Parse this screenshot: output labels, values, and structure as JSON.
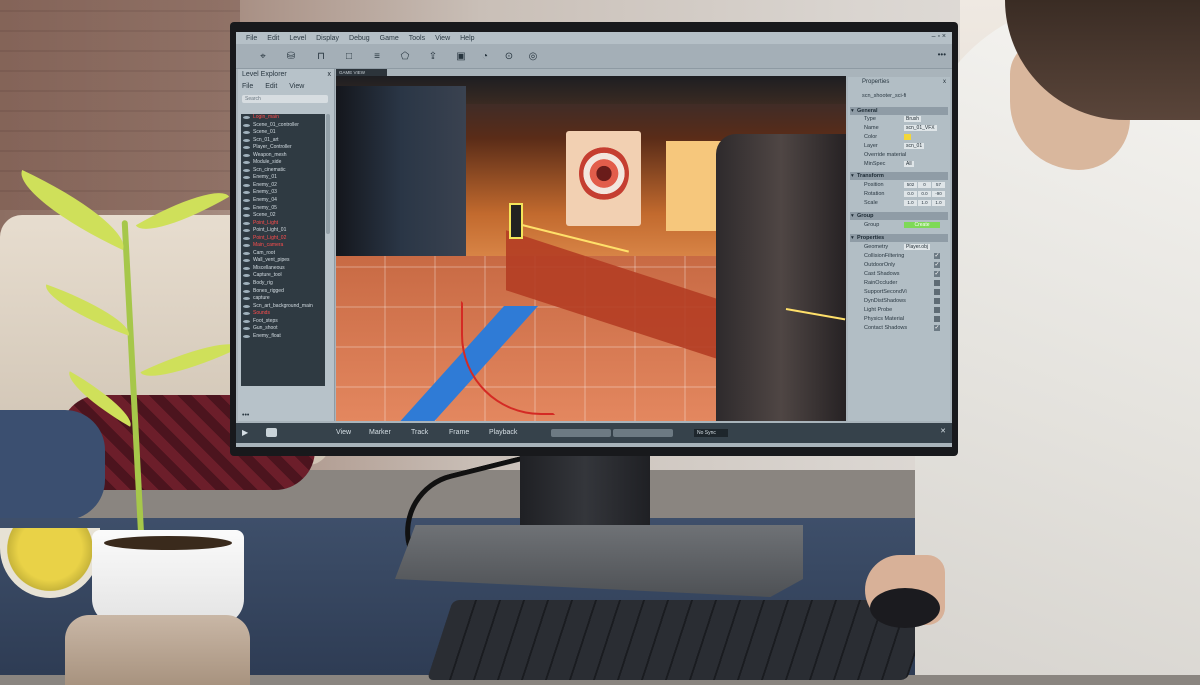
{
  "menu": [
    "File",
    "Edit",
    "Level",
    "Display",
    "Debug",
    "Game",
    "Tools",
    "View",
    "Help"
  ],
  "window_buttons": "– ▫ ×",
  "toolbar": {
    "icons": [
      "select-icon",
      "cylinder-icon",
      "brush-icon",
      "square-icon",
      "list-icon",
      "pentagon-icon",
      "export-icon",
      "save-icon",
      "user-icon",
      "settings-icon",
      "target-icon"
    ],
    "more": "•••"
  },
  "explorer": {
    "title": "Level Explorer",
    "close": "x",
    "menu": [
      "File",
      "Edit",
      "View"
    ],
    "search_placeholder": "Search",
    "items": [
      {
        "label": "Login_main",
        "highlight": true
      },
      {
        "label": "Scene_01_controller",
        "highlight": false
      },
      {
        "label": "Scene_01",
        "highlight": false
      },
      {
        "label": "Scn_01_art",
        "highlight": false
      },
      {
        "label": "Player_Controller",
        "highlight": false
      },
      {
        "label": "Weapon_mesh",
        "highlight": false
      },
      {
        "label": "Module_side",
        "highlight": false
      },
      {
        "label": "Scn_cinematic",
        "highlight": false
      },
      {
        "label": "Enemy_01",
        "highlight": false
      },
      {
        "label": "Enemy_02",
        "highlight": false
      },
      {
        "label": "Enemy_03",
        "highlight": false
      },
      {
        "label": "Enemy_04",
        "highlight": false
      },
      {
        "label": "Enemy_05",
        "highlight": false
      },
      {
        "label": "Scene_02",
        "highlight": false
      },
      {
        "label": "Point_Light",
        "highlight": true
      },
      {
        "label": "Point_Light_01",
        "highlight": false
      },
      {
        "label": "Point_Light_02",
        "highlight": true
      },
      {
        "label": "Main_camera",
        "highlight": true
      },
      {
        "label": "Cam_root",
        "highlight": false
      },
      {
        "label": "Wall_vent_pipes",
        "highlight": false
      },
      {
        "label": "Miscellaneous",
        "highlight": false
      },
      {
        "label": "Capture_tool",
        "highlight": false
      },
      {
        "label": "Body_rig",
        "highlight": false
      },
      {
        "label": "Bones_rigged",
        "highlight": false
      },
      {
        "label": "capture",
        "highlight": false
      },
      {
        "label": "Scn_art_background_main",
        "highlight": false
      },
      {
        "label": "Sounds",
        "highlight": true
      },
      {
        "label": "Foot_steps",
        "highlight": false
      },
      {
        "label": "Gun_shoot",
        "highlight": false
      },
      {
        "label": "Enemy_float",
        "highlight": false
      }
    ],
    "more": "•••"
  },
  "viewport": {
    "tab": "GAME VIEW"
  },
  "properties": {
    "title": "Properties",
    "close": "x",
    "object": "scn_shooter_sci-fi",
    "general": {
      "label": "General",
      "type_label": "Type",
      "type_value": "Brush",
      "name_label": "Name",
      "name_value": "scn_01_VFX",
      "color_label": "Color",
      "color_value": "#f2d63a",
      "layer_label": "Layer",
      "layer_value": "scn_01",
      "override_label": "Override material",
      "minspec_label": "MinSpec",
      "minspec_value": "All"
    },
    "transform": {
      "label": "Transform",
      "position_label": "Position",
      "position": [
        "502",
        "0",
        "57"
      ],
      "rotation_label": "Rotation",
      "rotation": [
        "0.0",
        "0.0",
        "-90"
      ],
      "scale_label": "Scale",
      "scale": [
        "1.0",
        "1.0",
        "1.0"
      ]
    },
    "group": {
      "label": "Group",
      "group_label": "Group",
      "create_label": "Create"
    },
    "props": {
      "label": "Properties",
      "geometry_label": "Geometry",
      "geometry_value": "Player.obj",
      "flags": [
        {
          "label": "CollisionFiltering",
          "checked": true
        },
        {
          "label": "OutdoorOnly",
          "checked": true
        },
        {
          "label": "Cast Shadows",
          "checked": true
        },
        {
          "label": "RainOccluder",
          "checked": false
        },
        {
          "label": "SupportSecondVi",
          "checked": false
        },
        {
          "label": "DynDistShadows",
          "checked": false
        },
        {
          "label": "Light Probe",
          "checked": false
        },
        {
          "label": "Physics Material",
          "checked": false
        },
        {
          "label": "Contact Shadows",
          "checked": true
        }
      ]
    },
    "more": "•••"
  },
  "timeline": {
    "play": "▶",
    "items": [
      "View",
      "Marker",
      "Track",
      "Frame",
      "Playback"
    ],
    "sync": "No Sync",
    "close": "✕"
  }
}
